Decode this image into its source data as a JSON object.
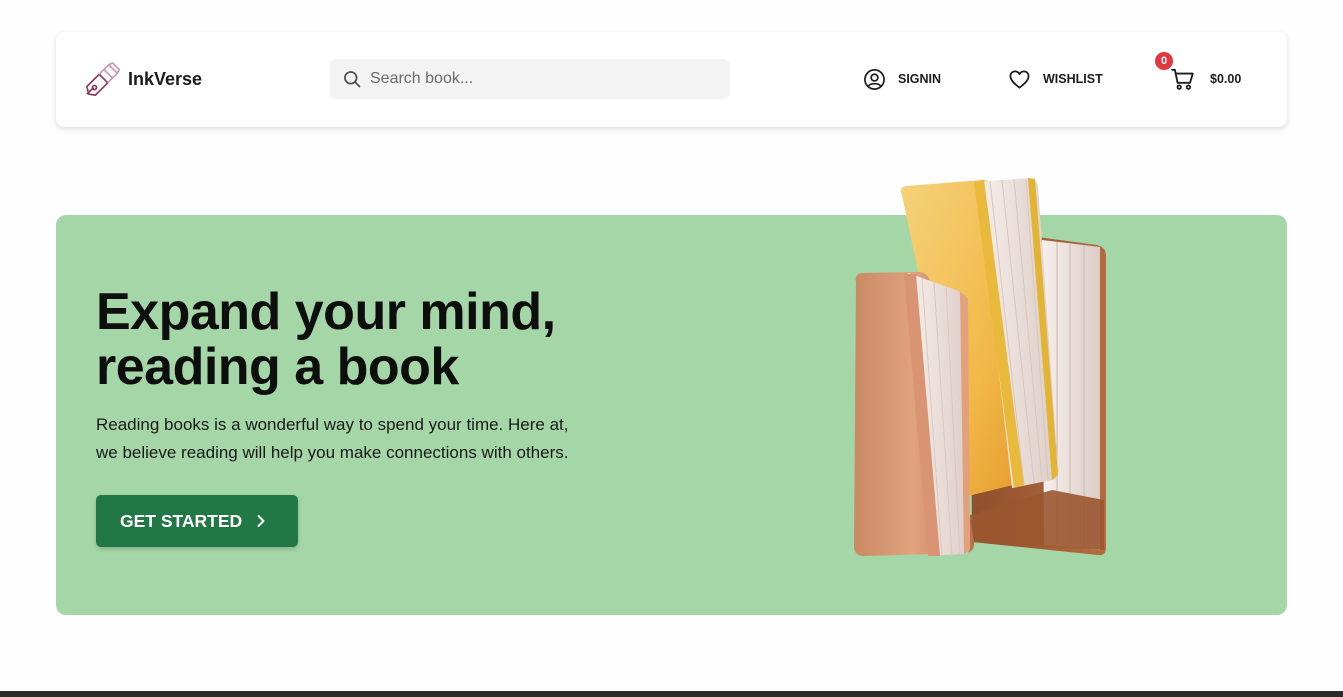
{
  "brand": {
    "name": "InkVerse",
    "logo_icon": "pen-nib-icon"
  },
  "search": {
    "placeholder": "Search book...",
    "value": ""
  },
  "nav": {
    "signin_label": "SIGNIN",
    "wishlist_label": "WISHLIST",
    "cart_count": "0",
    "cart_total": "$0.00"
  },
  "hero": {
    "title_line1": "Expand your mind,",
    "title_line2": "reading a book",
    "text_line1": "Reading books is a wonderful way to spend your time. Here at,",
    "text_line2": "we believe reading will help you make connections with others.",
    "cta_label": "GET STARTED",
    "illustration": "stacked-books-illustration"
  },
  "colors": {
    "hero_bg": "#a5d6a7",
    "cta_bg": "#217844",
    "badge": "#e0383e",
    "logo_accent": "#8e3b5e"
  }
}
